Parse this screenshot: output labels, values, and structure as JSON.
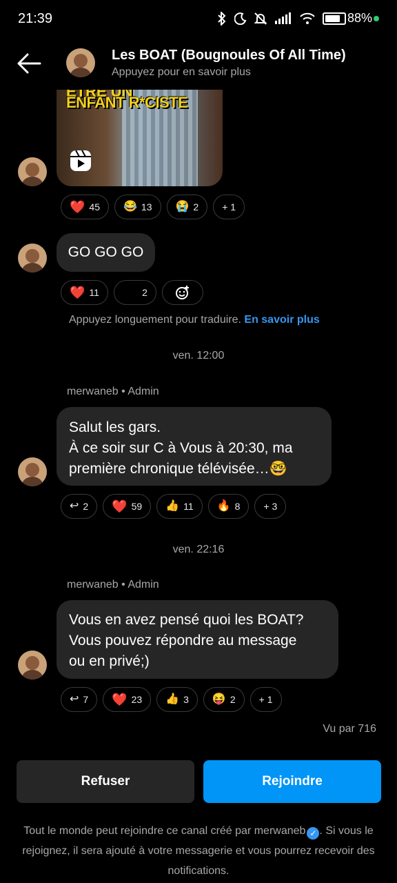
{
  "status_bar": {
    "time": "21:39",
    "battery": "88%",
    "battery_level": 0.88
  },
  "header": {
    "title": "Les BOAT (Bougnoules Of All Time)",
    "subtitle": "Appuyez pour en savoir plus"
  },
  "messages": [
    {
      "type": "media",
      "overlay_text_top": "ETRE UN",
      "overlay_text": "ENFANT R*CISTE",
      "reactions": [
        {
          "emoji": "❤️",
          "count": "45"
        },
        {
          "emoji": "😂",
          "count": "13"
        },
        {
          "emoji": "😭",
          "count": "2"
        },
        {
          "emoji": "",
          "count": "+ 1"
        }
      ]
    },
    {
      "type": "text",
      "lines": [
        "GO GO GO"
      ],
      "reactions": [
        {
          "emoji": "❤️",
          "count": "11"
        },
        {
          "emoji": "",
          "count": "2"
        }
      ],
      "hint": "Appuyez longuement pour traduire.",
      "hint_link": "En savoir plus"
    },
    {
      "type": "text",
      "timestamp": "ven. 12:00",
      "sender": "merwaneb • Admin",
      "lines": [
        "Salut les gars.",
        "À ce soir sur C à Vous à 20:30, ma",
        "première chronique télévisée…🤓"
      ],
      "reactions": [
        {
          "emoji": "↩",
          "count": "2"
        },
        {
          "emoji": "❤️",
          "count": "59"
        },
        {
          "emoji": "👍",
          "count": "11"
        },
        {
          "emoji": "🔥",
          "count": "8"
        },
        {
          "emoji": "",
          "count": "+ 3"
        }
      ]
    },
    {
      "type": "text",
      "timestamp": "ven. 22:16",
      "sender": "merwaneb • Admin",
      "lines": [
        "Vous en avez pensé quoi les BOAT?",
        "Vous pouvez répondre au message",
        "ou en privé;)"
      ],
      "reactions": [
        {
          "emoji": "↩",
          "count": "7"
        },
        {
          "emoji": "❤️",
          "count": "23"
        },
        {
          "emoji": "👍",
          "count": "3"
        },
        {
          "emoji": "😝",
          "count": "2"
        },
        {
          "emoji": "",
          "count": "+ 1"
        }
      ]
    }
  ],
  "seen_by": "Vu par 716",
  "actions": {
    "refuse": "Refuser",
    "join": "Rejoindre"
  },
  "footer": {
    "text_before": "Tout le monde peut rejoindre ce canal créé par merwaneb",
    "text_after": ". Si vous le rejoignez, il sera ajouté à votre messagerie et vous pourrez recevoir des notifications."
  },
  "colors": {
    "accent": "#0095f6",
    "link": "#3797f0",
    "bubble": "#262626",
    "background": "#000000"
  }
}
